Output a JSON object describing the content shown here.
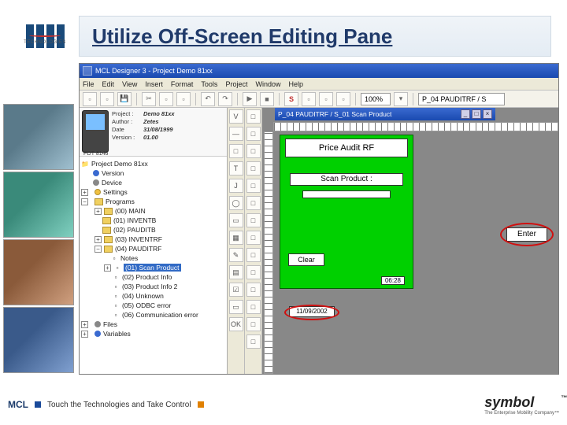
{
  "slide_title": "Utilize Off-Screen Editing Pane",
  "logo_text": "TECHNOLOGIES",
  "app": {
    "title": "MCL Designer 3 - Project Demo 81xx",
    "menus": [
      "File",
      "Edit",
      "View",
      "Insert",
      "Format",
      "Tools",
      "Project",
      "Window",
      "Help"
    ],
    "zoom": "100%",
    "screen_combo": "P_04  PAUDITRF / S",
    "s_badge": "S"
  },
  "project": {
    "labels": {
      "project": "Project :",
      "author": "Author :",
      "date": "Date",
      "version": "Version :"
    },
    "values": {
      "project": "Demo 81xx",
      "author": "Zetes",
      "date": "31/08/1999",
      "version": "01.00"
    },
    "device": "PDT 8146"
  },
  "tree": {
    "root": "Project Demo 81xx",
    "nodes": {
      "version": "Version",
      "device": "Device",
      "settings": "Settings",
      "programs": "Programs",
      "files": "Files",
      "variables": "Variables",
      "notes": "Notes"
    },
    "programs": [
      "(00) MAIN",
      "(01) INVENTB",
      "(02) PAUDITB",
      "(03) INVENTRF",
      "(04) PAUDITRF"
    ],
    "screens": [
      "(01) Scan Product",
      "(02) Product Info",
      "(03) Product Info 2",
      "(04) Unknown",
      "(05) ODBC error",
      "(06) Communication error"
    ],
    "selected": "(01) Scan Product"
  },
  "canvas": {
    "window_title": "P_04  PAUDITRF / S_01 Scan Product",
    "header": "Price Audit RF",
    "prompt": "Scan Product :",
    "clear": "Clear",
    "time": "06:28",
    "enter": "Enter",
    "date": "11/09/2002"
  },
  "vtools1": [
    "V",
    "—",
    "□",
    "T",
    "J",
    "◯",
    "▭",
    "▦",
    "✎",
    "▤",
    "☑",
    "▭",
    "OK"
  ],
  "vtools2": [
    "□",
    "□",
    "□",
    "□",
    "□",
    "□",
    "□",
    "□",
    "□",
    "□",
    "□",
    "□",
    "□",
    "□"
  ],
  "footer": {
    "mcl": "MCL",
    "tagline": "Touch the Technologies and Take Control",
    "symbol": "symbol",
    "symbol_tag": "The Enterprise Mobility Company™"
  }
}
